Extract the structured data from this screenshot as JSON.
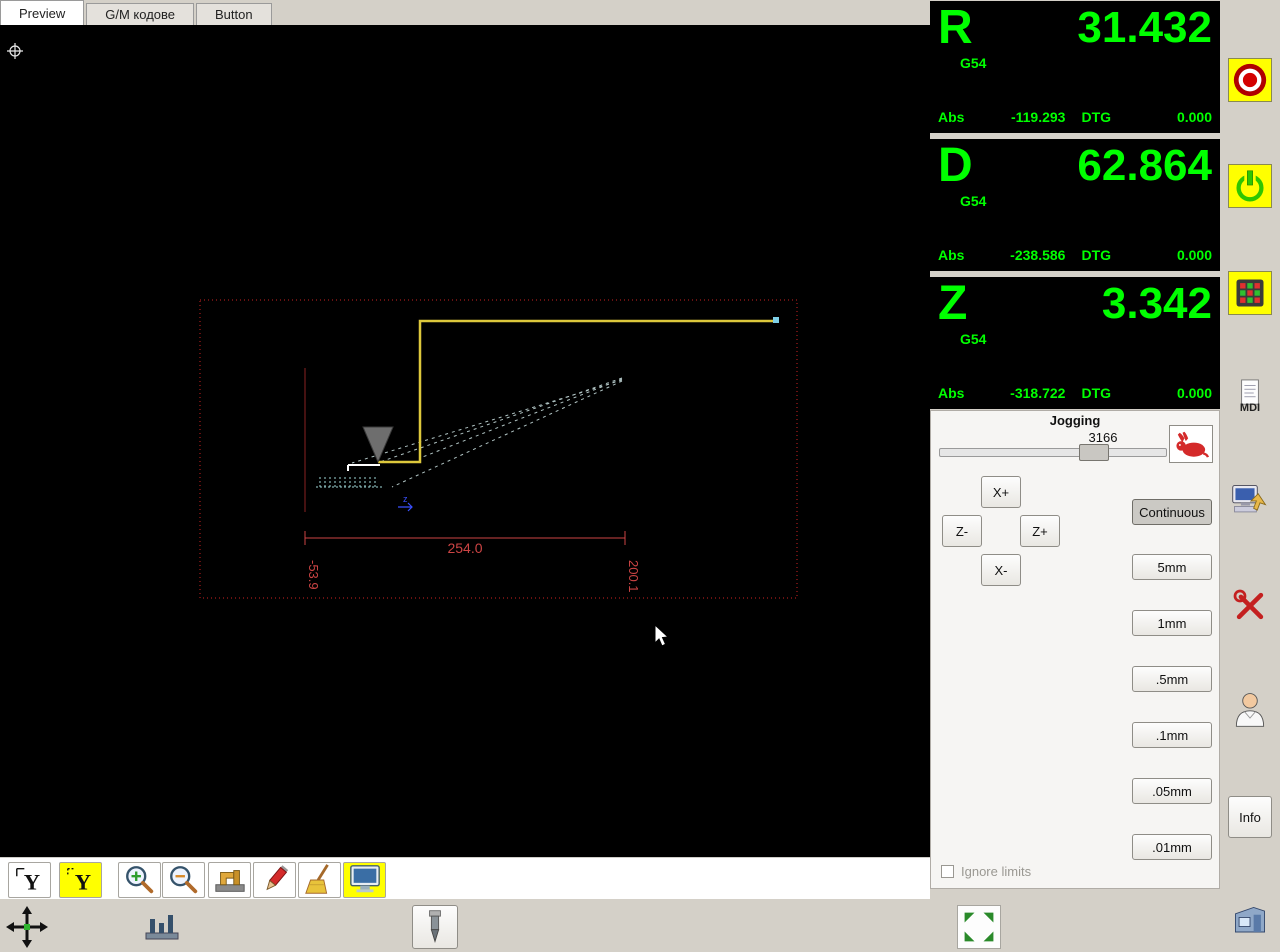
{
  "tabs": [
    {
      "label": "Preview"
    },
    {
      "label": "G/M кодове"
    },
    {
      "label": "Button"
    }
  ],
  "dro": [
    {
      "letter": "R",
      "value": "31.432",
      "system": "G54",
      "abs_label": "Abs",
      "abs_value": "-119.293",
      "dtg_label": "DTG",
      "dtg_value": "0.000"
    },
    {
      "letter": "D",
      "value": "62.864",
      "system": "G54",
      "abs_label": "Abs",
      "abs_value": "-238.586",
      "dtg_label": "DTG",
      "dtg_value": "0.000"
    },
    {
      "letter": "Z",
      "value": "3.342",
      "system": "G54",
      "abs_label": "Abs",
      "abs_value": "-318.722",
      "dtg_label": "DTG",
      "dtg_value": "0.000"
    }
  ],
  "jogging": {
    "title": "Jogging",
    "speed_value": "3166",
    "jog_x_plus": "X+",
    "jog_z_minus": "Z-",
    "jog_z_plus": "Z+",
    "jog_x_minus": "X-",
    "increments": [
      "Continuous",
      "5mm",
      "1mm",
      ".5mm",
      ".1mm",
      ".05mm",
      ".01mm"
    ],
    "selected_increment": "Continuous",
    "ignore_limits_label": "Ignore limits"
  },
  "preview": {
    "dim_width": "254.0",
    "dim_left": "-53.9",
    "dim_right": "200.1",
    "axis_marker": "z"
  },
  "right_panel": {
    "mdi_label": "MDI",
    "info_label": "Info"
  },
  "colors": {
    "dro_green": "#00ff00",
    "accent_yellow": "#ffff00",
    "dimension_red": "#cc4444",
    "toolpath_yellow": "#ddc83c",
    "limits_red": "#cc2222"
  },
  "icons": [
    "origin-crosshair-icon",
    "tool-cone-icon",
    "estop-icon",
    "power-icon",
    "keypad-icon",
    "mdi-icon",
    "touchscreen-icon",
    "tools-icon",
    "operator-icon",
    "lathe-icon",
    "rabbit-icon",
    "dim-y-icon",
    "dim-y-active-icon",
    "zoom-in-icon",
    "zoom-out-icon",
    "clamp-icon",
    "pencil-icon",
    "broom-icon",
    "monitor-icon",
    "jog-axes-icon",
    "tool-pins-icon",
    "spindle-tool-icon",
    "fullscreen-icon",
    "mouse-cursor-icon"
  ]
}
